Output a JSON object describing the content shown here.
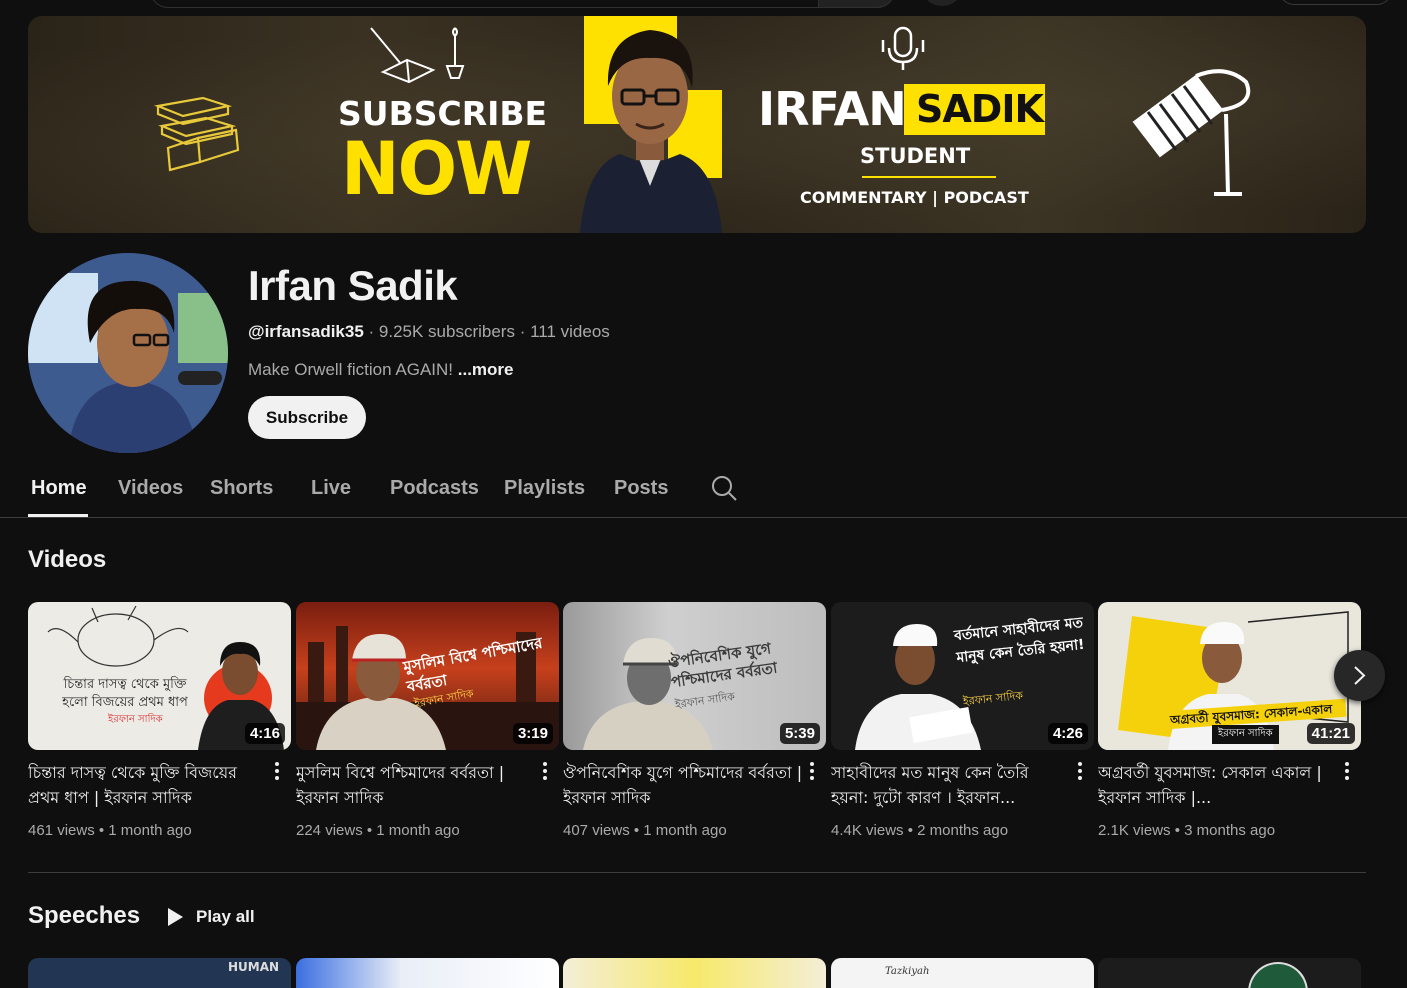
{
  "banner": {
    "subscribe_line1": "SUBSCRIBE",
    "subscribe_line2": "NOW",
    "name_first": "IRFAN",
    "name_last": "SADIK",
    "role": "STUDENT",
    "tagline": "COMMENTARY | PODCAST",
    "accent_color": "#ffe100"
  },
  "channel": {
    "name": "Irfan Sadik",
    "handle": "@irfansadik35",
    "subscribers": "9.25K subscribers",
    "video_count": "111 videos",
    "separator": " · ",
    "description": "Make Orwell fiction AGAIN!",
    "more_label": "...more",
    "subscribe_label": "Subscribe"
  },
  "tabs": [
    {
      "label": "Home",
      "active": true
    },
    {
      "label": "Videos",
      "active": false
    },
    {
      "label": "Shorts",
      "active": false
    },
    {
      "label": "Live",
      "active": false
    },
    {
      "label": "Podcasts",
      "active": false
    },
    {
      "label": "Playlists",
      "active": false
    },
    {
      "label": "Posts",
      "active": false
    }
  ],
  "sections": {
    "videos_title": "Videos",
    "speeches_title": "Speeches",
    "play_all_label": "Play all"
  },
  "videos": [
    {
      "title": "চিন্তার দাসত্ব থেকে মুক্তি বিজয়ের প্রথম ধাপ | ইরফান সাদিক",
      "duration": "4:16",
      "views": "461 views",
      "age": "1 month ago",
      "thumb_text": "চিন্তার দাসত্ব থেকে মুক্তি হলো বিজয়ের প্রথম ধাপ",
      "thumb_sub": "ইরফান সাদিক"
    },
    {
      "title": "মুসলিম বিশ্বে পশ্চিমাদের বর্বরতা | ইরফান সাদিক",
      "duration": "3:19",
      "views": "224 views",
      "age": "1 month ago",
      "thumb_text": "মুসলিম বিশ্বে পশ্চিমাদের বর্বরতা",
      "thumb_sub": "ইরফান সাদিক"
    },
    {
      "title": "ঔপনিবেশিক যুগে পশ্চিমাদের বর্বরতা | ইরফান সাদিক",
      "duration": "5:39",
      "views": "407 views",
      "age": "1 month ago",
      "thumb_text": "ঔপনিবেশিক যুগে পশ্চিমাদের বর্বরতা",
      "thumb_sub": "ইরফান সাদিক"
    },
    {
      "title": "সাহাবীদের মত মানুষ কেন তৈরি হয়না: দুটো কারণ । ইরফান...",
      "duration": "4:26",
      "views": "4.4K views",
      "age": "2 months ago",
      "thumb_text": "বর্তমানে সাহাবীদের মত মানুষ কেন তৈরি হয়না!",
      "thumb_sub": "ইরফান সাদিক"
    },
    {
      "title": "অগ্রবর্তী যুবসমাজ: সেকাল একাল | ইরফান সাদিক |...",
      "duration": "41:21",
      "views": "2.1K views",
      "age": "3 months ago",
      "thumb_text": "অগ্রবর্তী যুবসমাজ: সেকাল-একাল",
      "thumb_sub": "ইরফান সাদিক"
    }
  ],
  "speeches_strip": [
    {
      "thumb_text": "HUMAN"
    },
    {
      "thumb_text": ""
    },
    {
      "thumb_text": ""
    },
    {
      "thumb_text": "Tazkiyah"
    },
    {
      "thumb_text": ""
    }
  ],
  "icons": {
    "search": "search-icon",
    "next": "chevron-right-icon",
    "play": "play-icon",
    "more": "more-vert-icon"
  }
}
